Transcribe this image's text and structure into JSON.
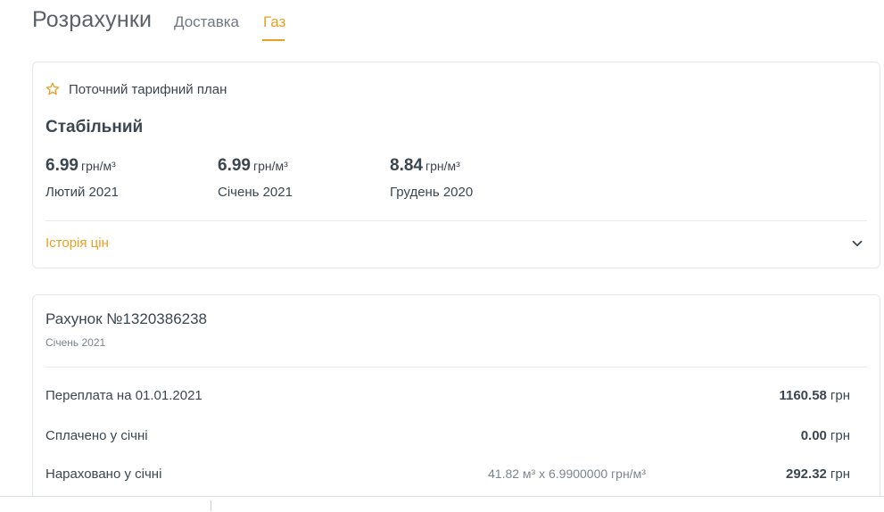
{
  "header": {
    "title": "Розрахунки",
    "tabs": [
      {
        "label": "Доставка",
        "active": false
      },
      {
        "label": "Газ",
        "active": true
      }
    ],
    "accent_color": "#e8a020"
  },
  "tariff": {
    "header_label": "Поточний тарифний план",
    "plan_name": "Стабільний",
    "prices": [
      {
        "value": "6.99",
        "unit": "грн/м³",
        "period": "Лютий 2021"
      },
      {
        "value": "6.99",
        "unit": "грн/м³",
        "period": "Січень 2021"
      },
      {
        "value": "8.84",
        "unit": "грн/м³",
        "period": "Грудень 2020"
      }
    ],
    "history_label": "Історія цін"
  },
  "bill": {
    "title": "Рахунок №1320386238",
    "period": "Січень 2021",
    "rows": [
      {
        "label": "Переплата на 01.01.2021",
        "calc": "",
        "amount": "1160.58",
        "currency": "грн"
      },
      {
        "label": "Сплачено у січні",
        "calc": "",
        "amount": "0.00",
        "currency": "грн"
      },
      {
        "label": "Нараховано у січні",
        "calc": "41.82 м³ x 6.9900000 грн/м³",
        "amount": "292.32",
        "currency": "грн"
      }
    ]
  },
  "icons": {
    "star": "star-icon",
    "chevron": "chevron-down-icon"
  }
}
